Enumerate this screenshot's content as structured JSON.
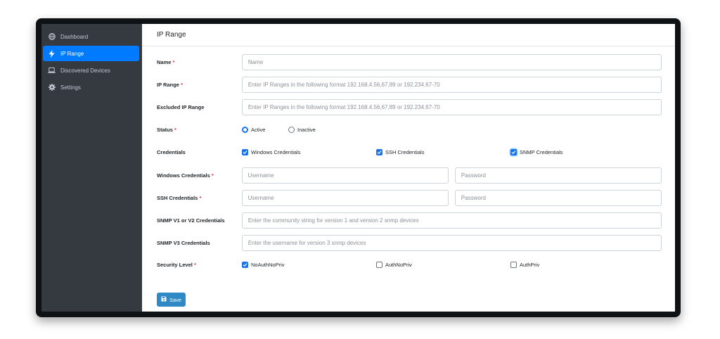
{
  "sidebar": {
    "items": [
      {
        "label": "Dashboard",
        "icon": "globe-icon"
      },
      {
        "label": "IP Range",
        "icon": "bolt-icon",
        "active": true
      },
      {
        "label": "Discovered Devices",
        "icon": "laptop-icon"
      },
      {
        "label": "Settings",
        "icon": "gear-icon"
      }
    ]
  },
  "page": {
    "title": "IP Range"
  },
  "form": {
    "name": {
      "label": "Name",
      "required": "*",
      "placeholder": "Name"
    },
    "ip_range": {
      "label": "IP Range",
      "required": "*",
      "placeholder": "Enter IP Ranges in the following format 192.168.4.56,67,89 or 192.234.67-70"
    },
    "excluded_ip_range": {
      "label": "Excluded IP Range",
      "placeholder": "Enter IP Ranges in the following format 192.168.4.56,67,89 or 192.234.67-70"
    },
    "status": {
      "label": "Status",
      "required": "*",
      "options": [
        {
          "label": "Active",
          "checked": true
        },
        {
          "label": "Inactive",
          "checked": false
        }
      ]
    },
    "credentials": {
      "label": "Credentials",
      "options": [
        {
          "label": "Windows Credentials",
          "checked": true
        },
        {
          "label": "SSH Credentials",
          "checked": true
        },
        {
          "label": "SNMP Credentials",
          "checked": true
        }
      ]
    },
    "windows_credentials": {
      "label": "Windows Credentials",
      "required": "*",
      "username_placeholder": "Username",
      "password_placeholder": "Password"
    },
    "ssh_credentials": {
      "label": "SSH Credentials",
      "required": "*",
      "username_placeholder": "Username",
      "password_placeholder": "Password"
    },
    "snmp_v1_v2": {
      "label": "SNMP V1 or V2 Credentials",
      "placeholder": "Enter the community string for version 1 and version 2 snmp devices"
    },
    "snmp_v3": {
      "label": "SNMP V3 Credentials",
      "placeholder": "Enter the username for version 3 snmp devices"
    },
    "security_level": {
      "label": "Security Level",
      "required": "*",
      "options": [
        {
          "label": "NoAuthNoPriv",
          "checked": true
        },
        {
          "label": "AuthNoPriv",
          "checked": false
        },
        {
          "label": "AuthPriv",
          "checked": false
        }
      ]
    },
    "save_label": "Save"
  },
  "colors": {
    "accent": "#007bff",
    "sidebar": "#343a40",
    "button": "#2f89c5",
    "required": "#dc3545"
  }
}
